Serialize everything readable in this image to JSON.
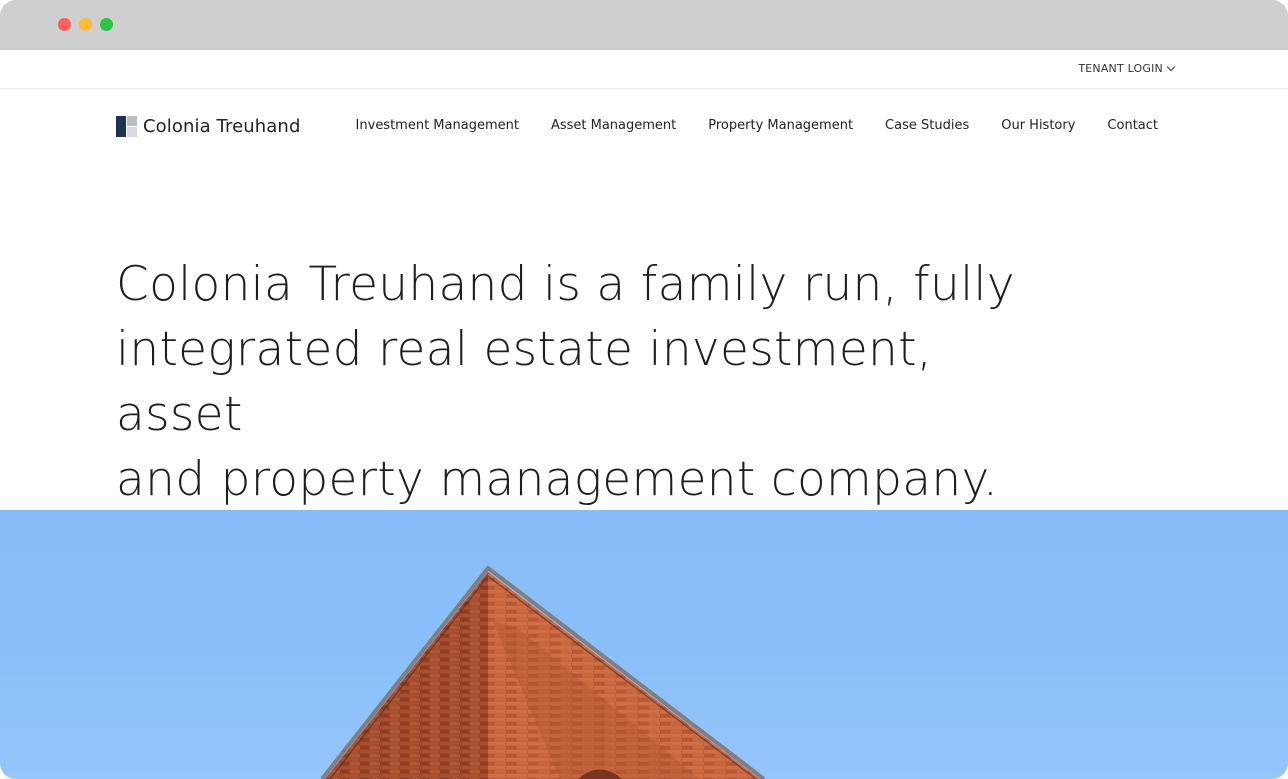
{
  "browser": {
    "controls": [
      "close",
      "minimize",
      "maximize"
    ],
    "colors": {
      "close": "#fe5f57",
      "minimize": "#febc2e",
      "maximize": "#28c840"
    }
  },
  "utility_bar": {
    "tenant_login_label": "TENANT LOGIN",
    "tenant_login_icon": "chevron-down-icon"
  },
  "header": {
    "logo_text": "Colonia Treuhand",
    "nav_items": [
      {
        "label": "Investment Management"
      },
      {
        "label": "Asset Management"
      },
      {
        "label": "Property Management"
      },
      {
        "label": "Case Studies"
      },
      {
        "label": "Our History"
      },
      {
        "label": "Contact"
      }
    ]
  },
  "hero": {
    "headline_lines": [
      "Colonia Treuhand is a family run, fully",
      "integrated real estate investment, asset",
      "and property management company."
    ]
  },
  "image": {
    "subject": "brick-building-corner",
    "sky_color": "#86bdf8",
    "brick_color": "#c2623b"
  },
  "colors": {
    "brand_navy": "#1b3454",
    "text": "#222222"
  }
}
